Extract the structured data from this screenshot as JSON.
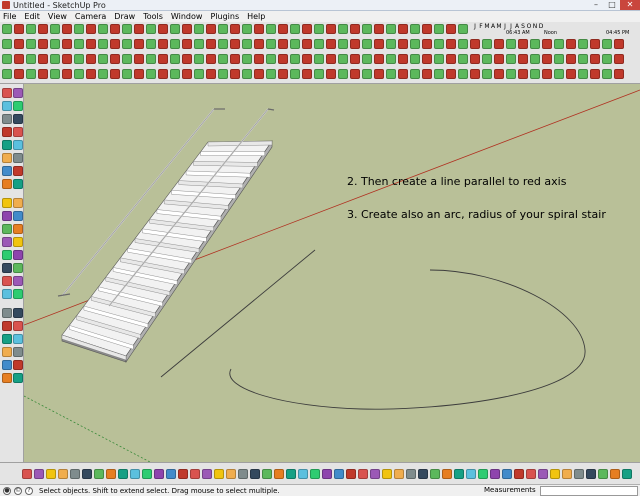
{
  "window": {
    "title": "Untitled - SketchUp Pro",
    "controls": [
      "–",
      "□",
      "✕"
    ]
  },
  "menu": [
    "File",
    "Edit",
    "View",
    "Camera",
    "Draw",
    "Tools",
    "Window",
    "Plugins",
    "Help"
  ],
  "shadow_settings": {
    "months": [
      "J",
      "F",
      "M",
      "A",
      "M",
      "J",
      "J",
      "A",
      "S",
      "O",
      "N",
      "D"
    ],
    "time_start": "06:43 AM",
    "time_mid": "Noon",
    "time_end": "04:45 PM"
  },
  "viewport": {
    "note1": "2. Then create a line parallel to red axis",
    "note2": "3. Create also an arc, radius of your spiral stair",
    "background_color": "#b9c098"
  },
  "status": {
    "message": "Select objects. Shift to extend select. Drag mouse to select multiple.",
    "measurements_label": "Measurements",
    "measurements_value": ""
  },
  "colors": {
    "red_axis": "#b03020",
    "green_axis": "#3a8a3a",
    "sketch_line": "#3c3c3c",
    "stair_top": "#f2f2f2",
    "stair_side": "#8a8a8a"
  }
}
